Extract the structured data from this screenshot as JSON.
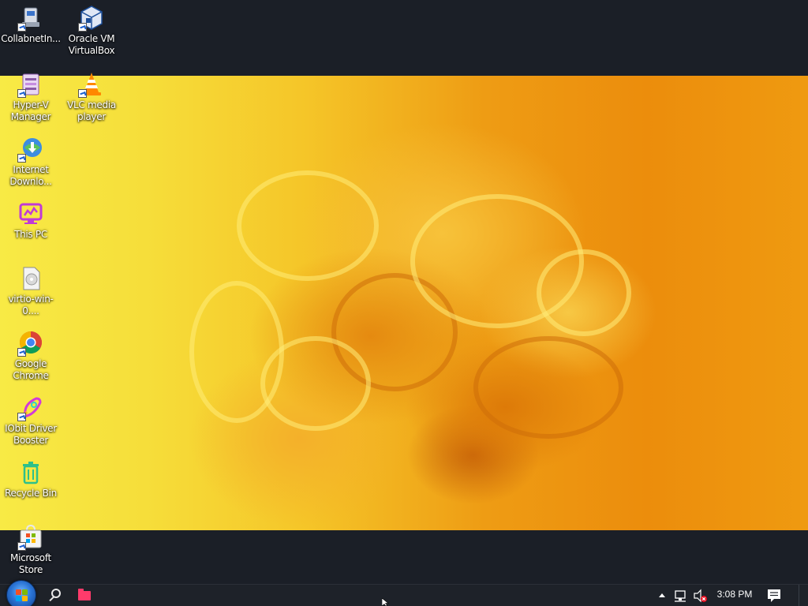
{
  "desktop_icons": [
    {
      "label": "CollabnetIn...",
      "icon": "collabnet-icon"
    },
    {
      "label": "Oracle VM VirtualBox",
      "icon": "virtualbox-icon"
    },
    {
      "label": "Hyper-V Manager",
      "icon": "hyperv-icon"
    },
    {
      "label": "VLC media player",
      "icon": "vlc-icon"
    },
    {
      "label": "Internet Downlo...",
      "icon": "idm-icon"
    },
    {
      "label": "This PC",
      "icon": "this-pc-icon"
    },
    {
      "label": "virtio-win-0....",
      "icon": "disc-image-icon"
    },
    {
      "label": "Google Chrome",
      "icon": "chrome-icon"
    },
    {
      "label": "IObit Driver Booster",
      "icon": "driver-booster-icon"
    },
    {
      "label": "Recycle Bin",
      "icon": "recycle-bin-icon"
    },
    {
      "label": "Microsoft Store",
      "icon": "store-icon"
    }
  ],
  "taskbar": {
    "start_icon": "windows-logo-icon",
    "search_icon": "search-icon",
    "pinned": [
      {
        "icon": "folder-icon",
        "color": "#ff3b6b"
      }
    ],
    "tray": {
      "overflow_icon": "chevron-up-icon",
      "network_icon": "network-icon",
      "volume_icon": "volume-muted-icon",
      "notifications_icon": "notification-icon"
    },
    "clock": "3:08 PM"
  },
  "colors": {
    "taskbar_bg": "#1e2229",
    "desktop_bg": "#1b1f27",
    "wallpaper_yellow": "#f8ea45",
    "wallpaper_orange": "#ec8d0c"
  }
}
